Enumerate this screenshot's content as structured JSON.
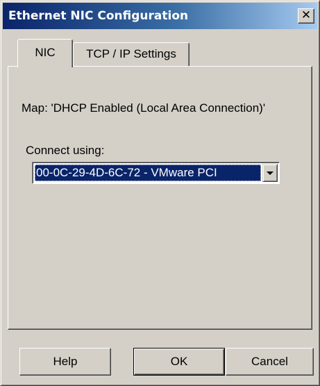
{
  "window": {
    "title": "Ethernet NIC Configuration",
    "close_glyph": "✕"
  },
  "tabs": [
    {
      "label": "NIC",
      "active": true
    },
    {
      "label": "TCP / IP Settings",
      "active": false
    }
  ],
  "nic_tab": {
    "map_text": "Map:  'DHCP Enabled (Local Area Connection)'",
    "connect_label": "Connect using:",
    "connect_value": "00-0C-29-4D-6C-72  -  VMware  PCI"
  },
  "buttons": {
    "help": "Help",
    "ok": "OK",
    "cancel": "Cancel"
  },
  "colors": {
    "titlebar_start": "#0a246a",
    "titlebar_end": "#a6caf0",
    "dialog_face": "#d4d0c8",
    "selection": "#0a246a"
  },
  "icons": {
    "close": "close-icon",
    "dropdown": "chevron-down-icon"
  }
}
